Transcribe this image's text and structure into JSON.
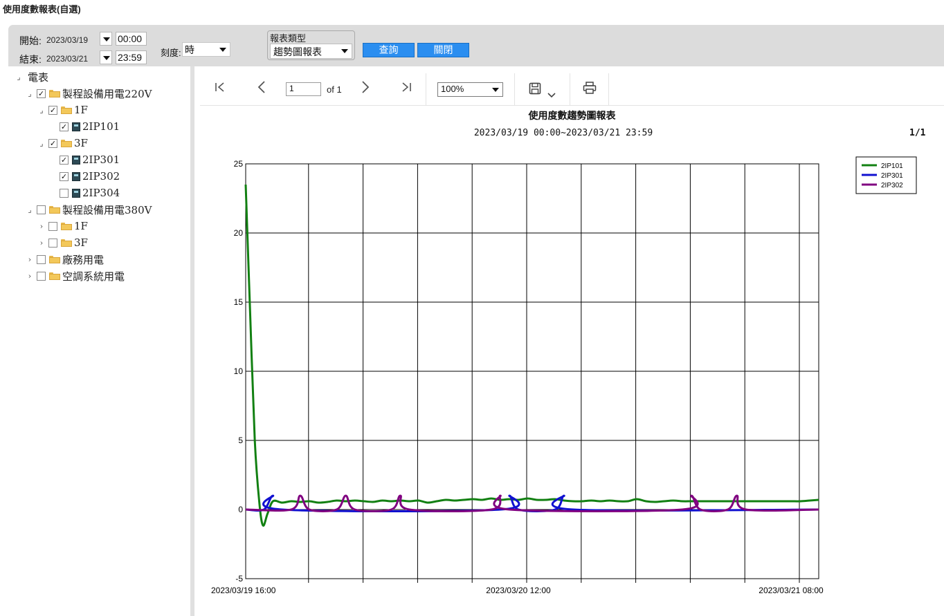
{
  "page_title": "使用度數報表(自選)",
  "toolbar": {
    "start_label": "開始:",
    "start_date": "2023/03/19",
    "start_time": "00:00",
    "end_label": "結束:",
    "end_date": "2023/03/21",
    "end_time": "23:59",
    "scale_label": "刻度:",
    "scale_value": "時",
    "report_type_label": "報表類型",
    "report_type_value": "趨勢圖報表",
    "query_button": "查詢",
    "close_button": "關閉"
  },
  "tree": {
    "root": "電表",
    "rows": [
      {
        "label": "製程設備用電220V",
        "toggle": "⌟",
        "checked": true,
        "icon": "folder"
      },
      {
        "label": "1F",
        "toggle": "⌟",
        "checked": true,
        "icon": "folder"
      },
      {
        "label": "2IP101",
        "toggle": "",
        "checked": true,
        "icon": "meter"
      },
      {
        "label": "3F",
        "toggle": "⌟",
        "checked": true,
        "icon": "folder"
      },
      {
        "label": "2IP301",
        "toggle": "",
        "checked": true,
        "icon": "meter"
      },
      {
        "label": "2IP302",
        "toggle": "",
        "checked": true,
        "icon": "meter"
      },
      {
        "label": "2IP304",
        "toggle": "",
        "checked": false,
        "icon": "meter"
      },
      {
        "label": "製程設備用電380V",
        "toggle": "⌟",
        "checked": false,
        "icon": "folder"
      },
      {
        "label": "1F",
        "toggle": "›",
        "checked": false,
        "icon": "folder"
      },
      {
        "label": "3F",
        "toggle": "›",
        "checked": false,
        "icon": "folder"
      },
      {
        "label": "廠務用電",
        "toggle": "›",
        "checked": false,
        "icon": "folder"
      },
      {
        "label": "空調系統用電",
        "toggle": "›",
        "checked": false,
        "icon": "folder"
      }
    ]
  },
  "viewer": {
    "page_number": "1",
    "of_label": "of 1",
    "zoom": "100%",
    "icons": [
      "first-page-icon",
      "prev-page-icon",
      "next-page-icon",
      "last-page-icon",
      "save-icon",
      "chevron-down-icon",
      "print-icon"
    ]
  },
  "report": {
    "title": "使用度數趨勢圖報表",
    "range": "2023/03/19 00:00~2023/03/21 23:59",
    "page_counter": "1/1"
  },
  "chart_data": {
    "type": "line",
    "x_tick_labels": [
      "2023/03/19 16:00",
      "2023/03/20 12:00",
      "2023/03/21 08:00"
    ],
    "x_range": [
      0,
      63
    ],
    "ylim": [
      -5,
      25
    ],
    "yticks": [
      -5,
      0,
      5,
      10,
      15,
      20,
      25
    ],
    "grid": true,
    "legend_position": "top-right",
    "series": [
      {
        "name": "2IP101",
        "color": "#128012",
        "points": [
          [
            0,
            23.5
          ],
          [
            0.5,
            14
          ],
          [
            1,
            5
          ],
          [
            1.5,
            0.5
          ],
          [
            1.9,
            -1.15
          ],
          [
            2.4,
            -0.3
          ],
          [
            3,
            0.6
          ],
          [
            4,
            0.5
          ],
          [
            5,
            0.6
          ],
          [
            6,
            0.55
          ],
          [
            7,
            0.6
          ],
          [
            8,
            0.5
          ],
          [
            9,
            0.55
          ],
          [
            10,
            0.65
          ],
          [
            11,
            0.6
          ],
          [
            12,
            0.65
          ],
          [
            13,
            0.6
          ],
          [
            14,
            0.55
          ],
          [
            15,
            0.65
          ],
          [
            16,
            0.6
          ],
          [
            17,
            0.65
          ],
          [
            18,
            0.6
          ],
          [
            19,
            0.65
          ],
          [
            20,
            0.5
          ],
          [
            21,
            0.6
          ],
          [
            22,
            0.7
          ],
          [
            23,
            0.65
          ],
          [
            24,
            0.7
          ],
          [
            25,
            0.75
          ],
          [
            26,
            0.7
          ],
          [
            27,
            0.8
          ],
          [
            28,
            0.7
          ],
          [
            29,
            0.75
          ],
          [
            30,
            0.7
          ],
          [
            31,
            0.8
          ],
          [
            32,
            0.7
          ],
          [
            33,
            0.7
          ],
          [
            34,
            0.75
          ],
          [
            35,
            0.65
          ],
          [
            36,
            0.6
          ],
          [
            37,
            0.6
          ],
          [
            38,
            0.65
          ],
          [
            39,
            0.6
          ],
          [
            40,
            0.65
          ],
          [
            41,
            0.6
          ],
          [
            42,
            0.6
          ],
          [
            43,
            0.75
          ],
          [
            44,
            0.6
          ],
          [
            45,
            0.55
          ],
          [
            46,
            0.6
          ],
          [
            47,
            0.65
          ],
          [
            48,
            0.6
          ],
          [
            49,
            0.6
          ],
          [
            50,
            0.6
          ],
          [
            51,
            0.6
          ],
          [
            52,
            0.6
          ],
          [
            53,
            0.6
          ],
          [
            54,
            0.6
          ],
          [
            55,
            0.6
          ],
          [
            56,
            0.6
          ],
          [
            57,
            0.6
          ],
          [
            58,
            0.6
          ],
          [
            59,
            0.6
          ],
          [
            60,
            0.6
          ],
          [
            61,
            0.6
          ],
          [
            62,
            0.65
          ],
          [
            63,
            0.7
          ]
        ]
      },
      {
        "name": "2IP301",
        "color": "#1010d0",
        "points": [
          [
            0,
            0
          ],
          [
            2.0,
            0
          ],
          [
            3,
            1.0
          ],
          [
            4,
            0
          ],
          [
            28,
            0
          ],
          [
            29,
            1.0
          ],
          [
            30,
            0
          ],
          [
            34,
            0
          ],
          [
            35,
            1.0
          ],
          [
            36,
            0
          ],
          [
            63,
            0
          ]
        ]
      },
      {
        "name": "2IP302",
        "color": "#800080",
        "points": [
          [
            0,
            0
          ],
          [
            5,
            0
          ],
          [
            6,
            1.0
          ],
          [
            7,
            0
          ],
          [
            10,
            0
          ],
          [
            11,
            1.0
          ],
          [
            12,
            0
          ],
          [
            16,
            0
          ],
          [
            17,
            1.0
          ],
          [
            18,
            0
          ],
          [
            27,
            0
          ],
          [
            28,
            1.0
          ],
          [
            29,
            0
          ],
          [
            48,
            0
          ],
          [
            49,
            1.0
          ],
          [
            50,
            0
          ],
          [
            53,
            0
          ],
          [
            54,
            1.0
          ],
          [
            55,
            0
          ],
          [
            63,
            0
          ]
        ]
      }
    ]
  }
}
